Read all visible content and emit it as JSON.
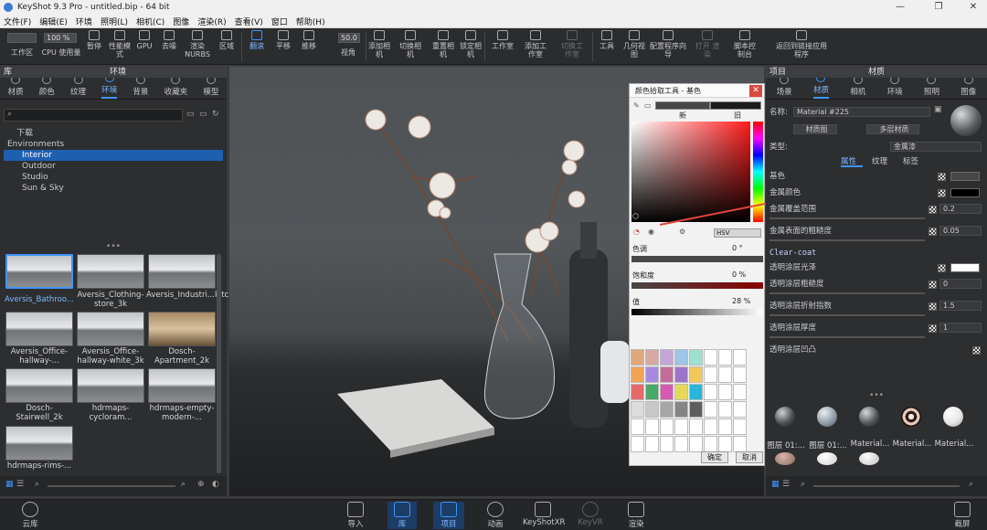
{
  "window": {
    "title": "KeyShot 9.3 Pro - untitled.bip - 64 bit"
  },
  "menu": [
    "文件(F)",
    "编辑(E)",
    "环境",
    "照明(L)",
    "相机(C)",
    "图像",
    "渲染(R)",
    "查看(V)",
    "窗口",
    "帮助(H)"
  ],
  "toolbar": {
    "items": [
      "工作区",
      "CPU 使用量",
      "暂停",
      "性能模式",
      "GPU",
      "去噪",
      "渲染 NURBS",
      "区域",
      "翻滚",
      "平移",
      "推移",
      "视角",
      "添加相机",
      "切换相机",
      "重置相机",
      "锁定相机",
      "工作室",
      "添加工作室",
      "切换工作室",
      "工具",
      "几何视图",
      "配置程序向导",
      "打开 渲染",
      "脚本控制台",
      "返回到链接应用程序"
    ],
    "cpu_value": "100 %",
    "fov_value": "50.0"
  },
  "library": {
    "header": "库",
    "section_header": "环境",
    "tabs": [
      "材质",
      "颜色",
      "纹理",
      "环境",
      "背景",
      "收藏夹",
      "模型"
    ],
    "active_tab": "环境",
    "tree": [
      "下载",
      "Environments",
      "Interior",
      "Outdoor",
      "Studio",
      "Sun & Sky"
    ],
    "thumbnails": [
      "Aversis_Bathroo...",
      "Aversis_Clothing-store_3k",
      "Aversis_Industri...kitchen_3k",
      "Aversis_Office-hallway-...",
      "Aversis_Office-hallway-white_3k",
      "Dosch-Apartment_2k",
      "Dosch-Stairwell_2k",
      "hdrmaps-cycloram...",
      "hdrmaps-empty-modern-...",
      "hdrmaps-rims-..."
    ]
  },
  "picker": {
    "title": "颜色拾取工具 - 基色",
    "new_label": "新",
    "old_label": "旧",
    "mode": "HSV",
    "hue_label": "色调",
    "hue_value": "0 °",
    "sat_label": "饱和度",
    "sat_value": "0 %",
    "val_label": "值",
    "val_value": "28 %",
    "ok": "确定",
    "cancel": "取消",
    "swatches": [
      "#e0a77d",
      "#d8a8a2",
      "#c6a5d8",
      "#9dc5e8",
      "#9ce0cf",
      "#ffffff",
      "#ffffff",
      "#ffffff",
      "#f0a455",
      "#a78ae0",
      "#c56c9b",
      "#9e74c8",
      "#f1c85a",
      "#ffffff",
      "#ffffff",
      "#ffffff",
      "#e56a6a",
      "#48a86a",
      "#d55ab0",
      "#e5d95a",
      "#2ab6d6",
      "#ffffff",
      "#ffffff",
      "#ffffff",
      "#dddddd",
      "#c8c8c8",
      "#a6a6a6",
      "#858585",
      "#5e5e5e",
      "#ffffff",
      "#ffffff",
      "#ffffff",
      "#ffffff",
      "#ffffff",
      "#ffffff",
      "#ffffff",
      "#ffffff",
      "#ffffff",
      "#ffffff",
      "#ffffff",
      "#ffffff",
      "#ffffff",
      "#ffffff",
      "#ffffff",
      "#ffffff",
      "#ffffff",
      "#ffffff",
      "#ffffff"
    ]
  },
  "properties": {
    "header": "项目",
    "section_header": "材质",
    "tabs": [
      "场景",
      "材质",
      "相机",
      "环境",
      "照明",
      "图像"
    ],
    "active_tab": "材质",
    "name_label": "名称:",
    "name_value": "Material #225",
    "btn_material_graph": "材质图",
    "btn_multi_material": "多层材质",
    "type_label": "类型:",
    "type_value": "金属漆",
    "subtabs": [
      "属性",
      "纹理",
      "标签"
    ],
    "rows": [
      {
        "label": "基色",
        "value": ""
      },
      {
        "label": "金属颜色",
        "value": ""
      },
      {
        "label": "金属覆盖范围",
        "value": "0.2"
      },
      {
        "label": "金属表面的粗糙度",
        "value": "0.05"
      },
      {
        "label": "Clear-coat",
        "value": ""
      },
      {
        "label": "透明涂层光泽",
        "value": ""
      },
      {
        "label": "透明涂层粗糙度",
        "value": "0"
      },
      {
        "label": "透明涂层折射指数",
        "value": "1.5"
      },
      {
        "label": "透明涂层厚度",
        "value": "1"
      },
      {
        "label": "透明涂层凹凸",
        "value": ""
      }
    ],
    "materials": [
      "图层 01:...",
      "图层 01:...",
      "Material...",
      "Material...",
      "Material..."
    ]
  },
  "bottom": {
    "cloud": "云库",
    "items": [
      "导入",
      "库",
      "项目",
      "动画",
      "KeyShotXR",
      "KeyVR",
      "渲染"
    ],
    "screenshot": "截屏"
  },
  "colors": {
    "accent": "#3f95ff",
    "arrow": "#e0463a"
  }
}
